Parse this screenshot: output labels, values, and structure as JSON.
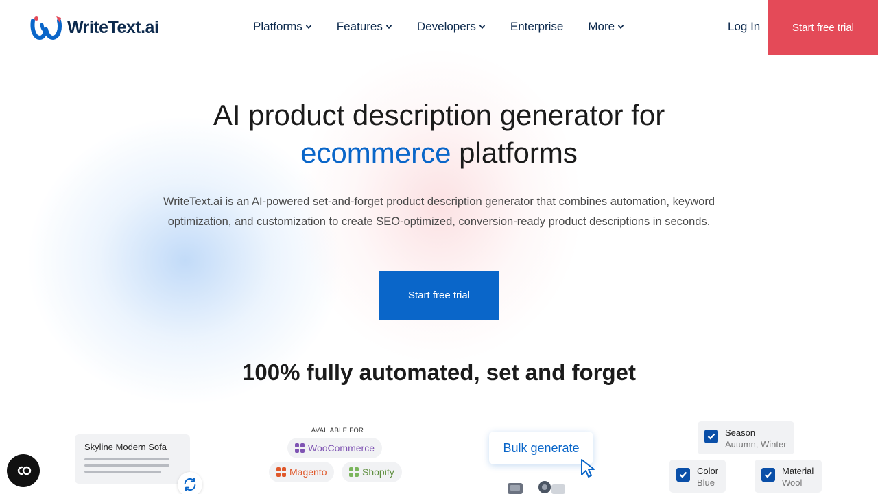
{
  "header": {
    "logo_text": "WriteText.ai",
    "nav": [
      {
        "label": "Platforms",
        "dropdown": true
      },
      {
        "label": "Features",
        "dropdown": true
      },
      {
        "label": "Developers",
        "dropdown": true
      },
      {
        "label": "Enterprise",
        "dropdown": false
      },
      {
        "label": "More",
        "dropdown": true
      }
    ],
    "login_label": "Log In",
    "trial_label": "Start free trial"
  },
  "hero": {
    "title_line1": "AI product description generator for",
    "title_accent": "ecommerce",
    "title_line2_rest": " platforms",
    "subtitle": "WriteText.ai is an AI-powered set-and-forget product description generator that combines automation, keyword optimization, and customization to create SEO-optimized, conversion-ready product descriptions in seconds.",
    "cta_label": "Start free trial"
  },
  "section": {
    "title": "100% fully automated, set and forget"
  },
  "illustrations": {
    "product_card_title": "Skyline Modern Sofa",
    "available_for": "AVAILABLE FOR",
    "platforms": [
      "WooCommerce",
      "Magento",
      "Shopify"
    ],
    "bulk_label": "Bulk generate",
    "attributes": [
      {
        "key": "Season",
        "value": "Autumn, Winter"
      },
      {
        "key": "Color",
        "value": "Blue"
      },
      {
        "key": "Material",
        "value": "Wool"
      }
    ]
  },
  "colors": {
    "brand_blue": "#0a66c9",
    "brand_red": "#e44a58",
    "navy": "#0d2a4d"
  }
}
